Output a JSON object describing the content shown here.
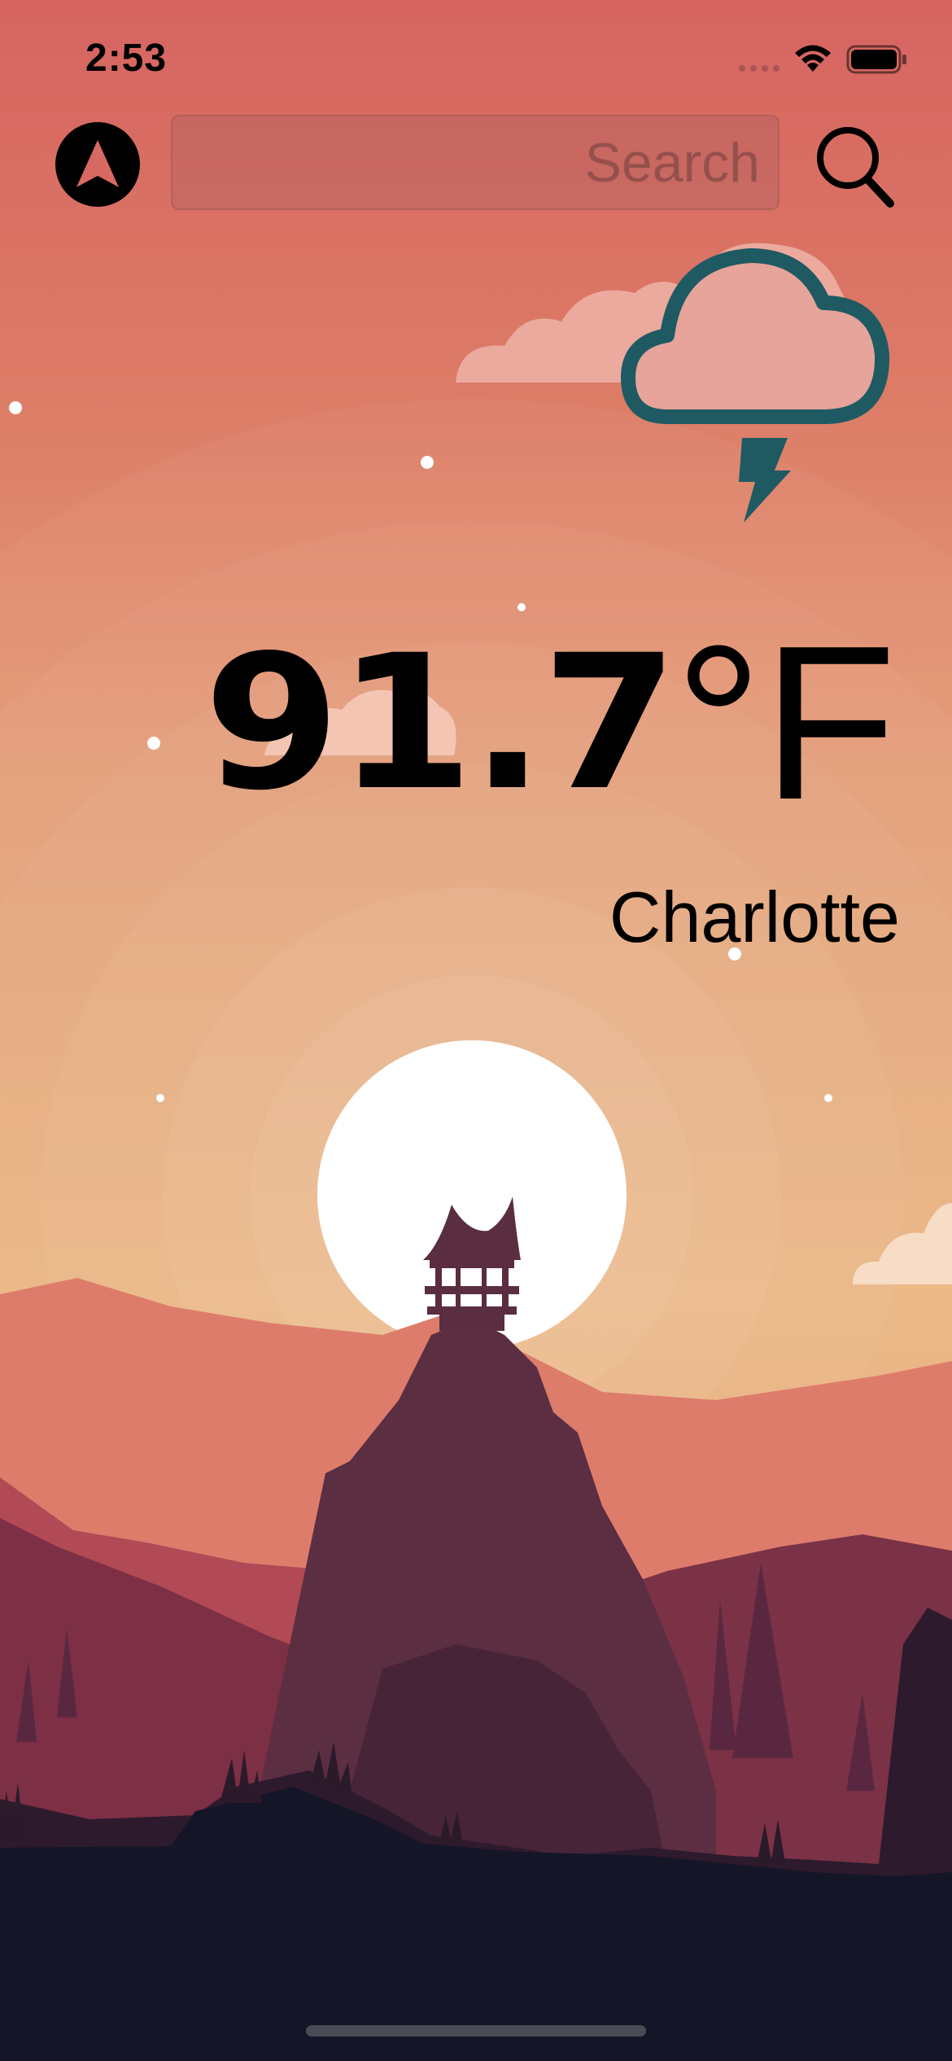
{
  "status_bar": {
    "time": "2:53",
    "icons": [
      "cellular-signal-icon",
      "wifi-icon",
      "battery-icon"
    ]
  },
  "toolbar": {
    "location_icon": "location-arrow-icon",
    "search_placeholder": "Search",
    "search_value": "",
    "search_icon": "magnifier-icon"
  },
  "weather": {
    "condition_icon": "thunderstorm-cloud-icon",
    "temperature": "91.7",
    "unit": "°F",
    "city": "Charlotte"
  },
  "colors": {
    "sky_top": "#d66461",
    "sky_bottom": "#ebb37c",
    "weather_icon": "#1f5a63",
    "sun": "#ffffff",
    "ground": "#141628"
  }
}
